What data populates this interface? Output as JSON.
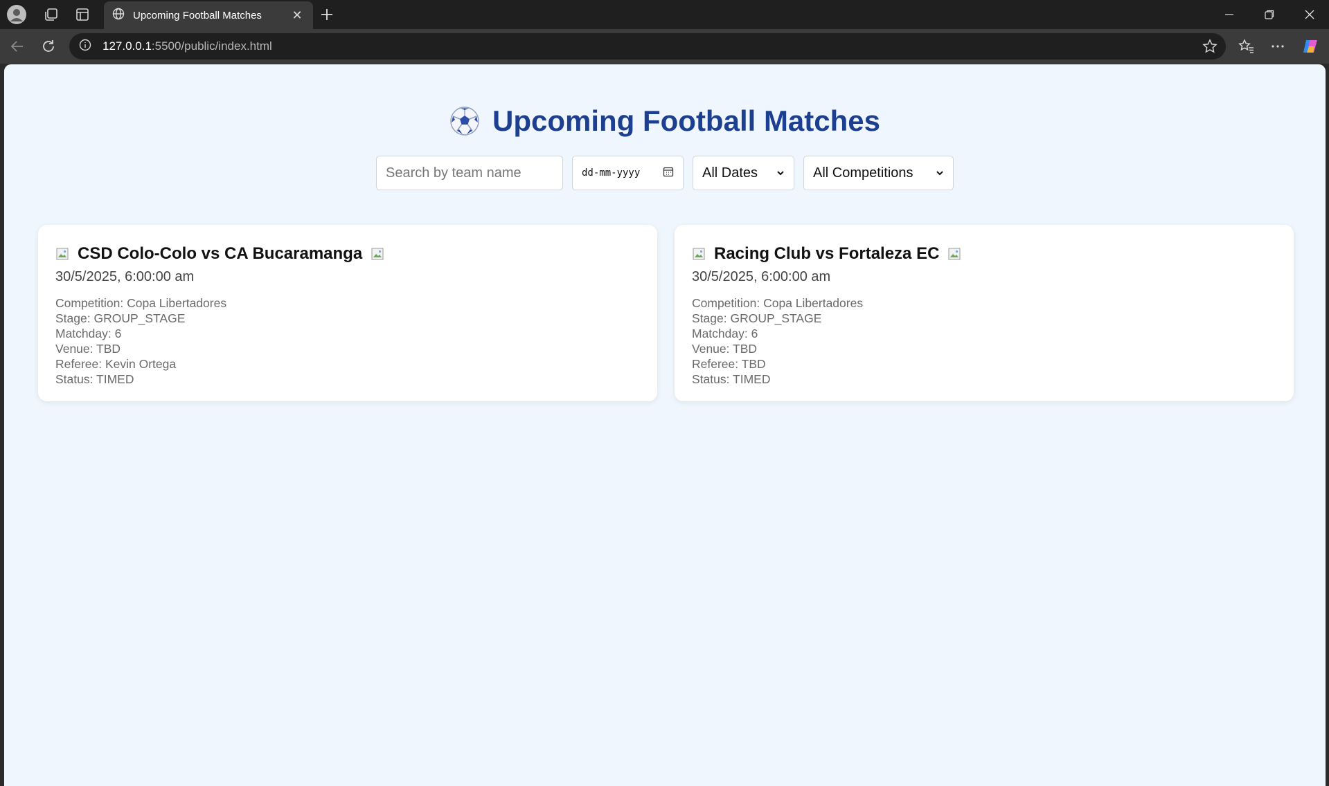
{
  "browser": {
    "tab_title": "Upcoming Football Matches",
    "url_host": "127.0.0.1",
    "url_path": ":5500/public/index.html"
  },
  "page": {
    "title": "Upcoming Football Matches",
    "search_placeholder": "Search by team name",
    "date_placeholder": "dd-mm-yyyy",
    "dates_filter": "All Dates",
    "competition_filter": "All Competitions"
  },
  "matches": [
    {
      "title": "CSD Colo-Colo vs CA Bucaramanga",
      "datetime": "30/5/2025, 6:00:00 am",
      "competition": "Competition: Copa Libertadores",
      "stage": "Stage: GROUP_STAGE",
      "matchday": "Matchday: 6",
      "venue": "Venue: TBD",
      "referee": "Referee: Kevin Ortega",
      "status": "Status: TIMED"
    },
    {
      "title": "Racing Club vs Fortaleza EC",
      "datetime": "30/5/2025, 6:00:00 am",
      "competition": "Competition: Copa Libertadores",
      "stage": "Stage: GROUP_STAGE",
      "matchday": "Matchday: 6",
      "venue": "Venue: TBD",
      "referee": "Referee: TBD",
      "status": "Status: TIMED"
    }
  ],
  "colors": {
    "heading": "#1d3f8f",
    "page_background": "#eff6fd",
    "card_background": "#ffffff"
  }
}
